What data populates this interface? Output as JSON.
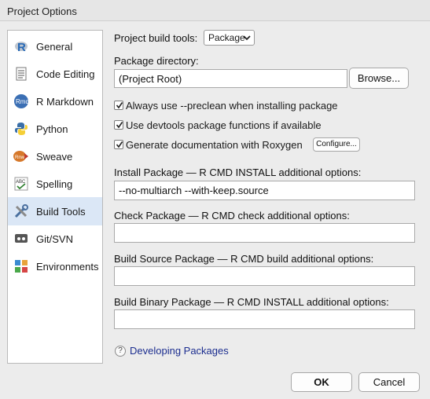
{
  "window": {
    "title": "Project Options"
  },
  "sidebar": {
    "items": [
      {
        "label": "General",
        "icon": "r-logo-icon"
      },
      {
        "label": "Code Editing",
        "icon": "document-icon"
      },
      {
        "label": "R Markdown",
        "icon": "rmd-icon"
      },
      {
        "label": "Python",
        "icon": "python-icon"
      },
      {
        "label": "Sweave",
        "icon": "sweave-icon"
      },
      {
        "label": "Spelling",
        "icon": "spellcheck-icon"
      },
      {
        "label": "Build Tools",
        "icon": "tools-icon"
      },
      {
        "label": "Git/SVN",
        "icon": "git-icon"
      },
      {
        "label": "Environments",
        "icon": "environments-icon"
      }
    ],
    "selected": "Build Tools"
  },
  "main": {
    "build_tools_label": "Project build tools:",
    "build_tools_value": "Package",
    "package_dir_label": "Package directory:",
    "package_dir_value": "(Project Root)",
    "browse_label": "Browse...",
    "checkboxes": [
      {
        "label": "Always use --preclean when installing package",
        "checked": true
      },
      {
        "label": "Use devtools package functions if available",
        "checked": true
      },
      {
        "label": "Generate documentation with Roxygen",
        "checked": true
      }
    ],
    "configure_label": "Configure...",
    "install_label": "Install Package — R CMD INSTALL additional options:",
    "install_value": "--no-multiarch --with-keep.source",
    "check_label": "Check Package — R CMD check additional options:",
    "check_value": "",
    "build_source_label": "Build Source Package — R CMD build additional options:",
    "build_source_value": "",
    "build_binary_label": "Build Binary Package — R CMD INSTALL additional options:",
    "build_binary_value": "",
    "help_link": "Developing Packages"
  },
  "footer": {
    "ok_label": "OK",
    "cancel_label": "Cancel"
  },
  "colors": {
    "selected_bg": "#dbe7f6",
    "link": "#1b2d8f",
    "r_blue": "#2769b6"
  }
}
